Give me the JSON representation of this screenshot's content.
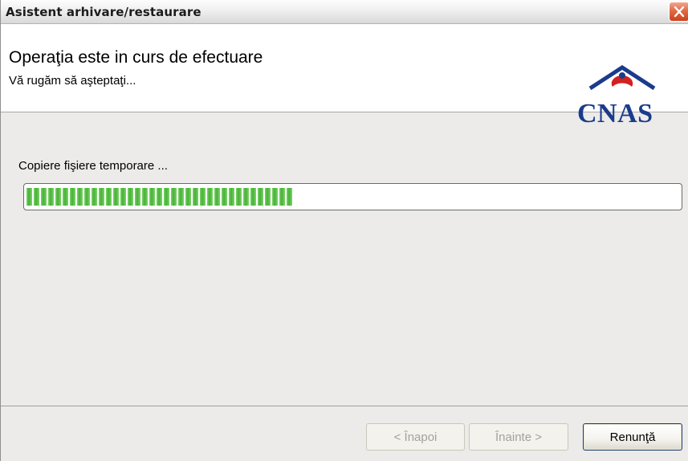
{
  "window": {
    "title": "Asistent arhivare/restaurare"
  },
  "header": {
    "title": "Operaţia este in curs de efectuare",
    "subtitle": "Vă rugăm să aşteptaţi...",
    "logo_text": "CNAS"
  },
  "main": {
    "status_text": "Copiere fişiere temporare ...",
    "progress_percent": 41
  },
  "buttons": {
    "back_label": "< Înapoi",
    "next_label": "Înainte >",
    "cancel_label": "Renunţă"
  },
  "icons": {
    "close": "close-icon",
    "logo": "cnas-logo"
  },
  "colors": {
    "progress_fill": "#44b234",
    "logo_blue": "#1b3b8c",
    "logo_red": "#d32020",
    "close_button": "#e26a46"
  }
}
